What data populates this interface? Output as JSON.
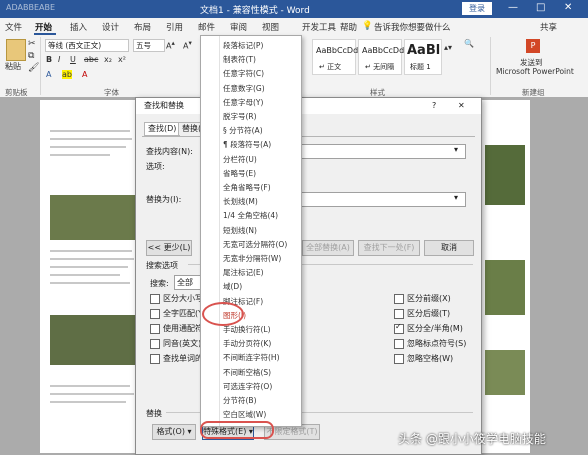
{
  "titlebar": {
    "left_text": "ADABBEABE",
    "title": "文档1 - 兼容性模式 - Word",
    "login": "登录",
    "minimize": "—",
    "restore": "□",
    "close": "✕"
  },
  "tabs": [
    "文件",
    "开始",
    "插入",
    "设计",
    "布局",
    "引用",
    "邮件",
    "审阅",
    "视图",
    "开发工具",
    "帮助"
  ],
  "search_hint": "告诉我你想要做什么",
  "share": "共享",
  "ribbon": {
    "font_name": "等线 (西文正文)",
    "font_size": "五号",
    "paste": "粘贴",
    "clipboard_label": "剪贴板",
    "font_label": "字体",
    "styles_label": "样式",
    "new_group_label": "新建组",
    "styles": [
      {
        "preview": "AaBbCcDd",
        "name": "↵ 正文"
      },
      {
        "preview": "AaBbCcDd",
        "name": "↵ 无间隔"
      },
      {
        "preview": "AaBl",
        "name": "标题 1"
      }
    ],
    "send_to_ppt_line1": "发送到",
    "send_to_ppt_line2": "Microsoft PowerPoint"
  },
  "dialog": {
    "title": "查找和替换",
    "help": "?",
    "close": "✕",
    "tabs": [
      "查找(D)",
      "替换(P)"
    ],
    "find_label": "查找内容(N):",
    "options_label": "选项:",
    "options_value": "区",
    "replace_label": "替换为(I):",
    "less_btn": "<< 更少(L)",
    "replace_all_btn": "全部替换(A)",
    "find_next_btn": "查找下一处(F)",
    "cancel_btn": "取消",
    "search_options": "搜索选项",
    "search_label": "搜索:",
    "search_value": "全部",
    "left_checks": [
      {
        "label": "区分大小写(H)",
        "checked": false
      },
      {
        "label": "全字匹配(Y)",
        "checked": false
      },
      {
        "label": "使用通配符(U)",
        "checked": false
      },
      {
        "label": "同音(英文)(K)",
        "checked": false
      },
      {
        "label": "查找单词的所有形式",
        "checked": false
      }
    ],
    "right_checks": [
      {
        "label": "区分前缀(X)",
        "checked": false
      },
      {
        "label": "区分后缀(T)",
        "checked": false
      },
      {
        "label": "区分全/半角(M)",
        "checked": true
      },
      {
        "label": "忽略标点符号(S)",
        "checked": false
      },
      {
        "label": "忽略空格(W)",
        "checked": false
      }
    ],
    "replace_section": "替换",
    "format_btn": "格式(O) ▾",
    "special_btn": "特殊格式(E) ▾",
    "no_format_btn": "不限定格式(T)"
  },
  "menu_items": [
    "段落标记(P)",
    "制表符(T)",
    "任意字符(C)",
    "任意数字(G)",
    "任意字母(Y)",
    "脱字号(R)",
    "§ 分节符(A)",
    "¶ 段落符号(A)",
    "分栏符(U)",
    "省略号(E)",
    "全角省略号(F)",
    "长划线(M)",
    "1/4 全角空格(4)",
    "短划线(N)",
    "无宽可选分隔符(O)",
    "无宽非分隔符(W)",
    "尾注标记(E)",
    "域(D)",
    "脚注标记(F)",
    "图形(I)",
    "手动换行符(L)",
    "手动分页符(K)",
    "不间断连字符(H)",
    "不间断空格(S)",
    "可选连字符(O)",
    "分节符(B)",
    "空白区域(W)"
  ],
  "highlighted_item": "图形(I)",
  "watermark": "头条 @跟小小筱学电脑技能"
}
